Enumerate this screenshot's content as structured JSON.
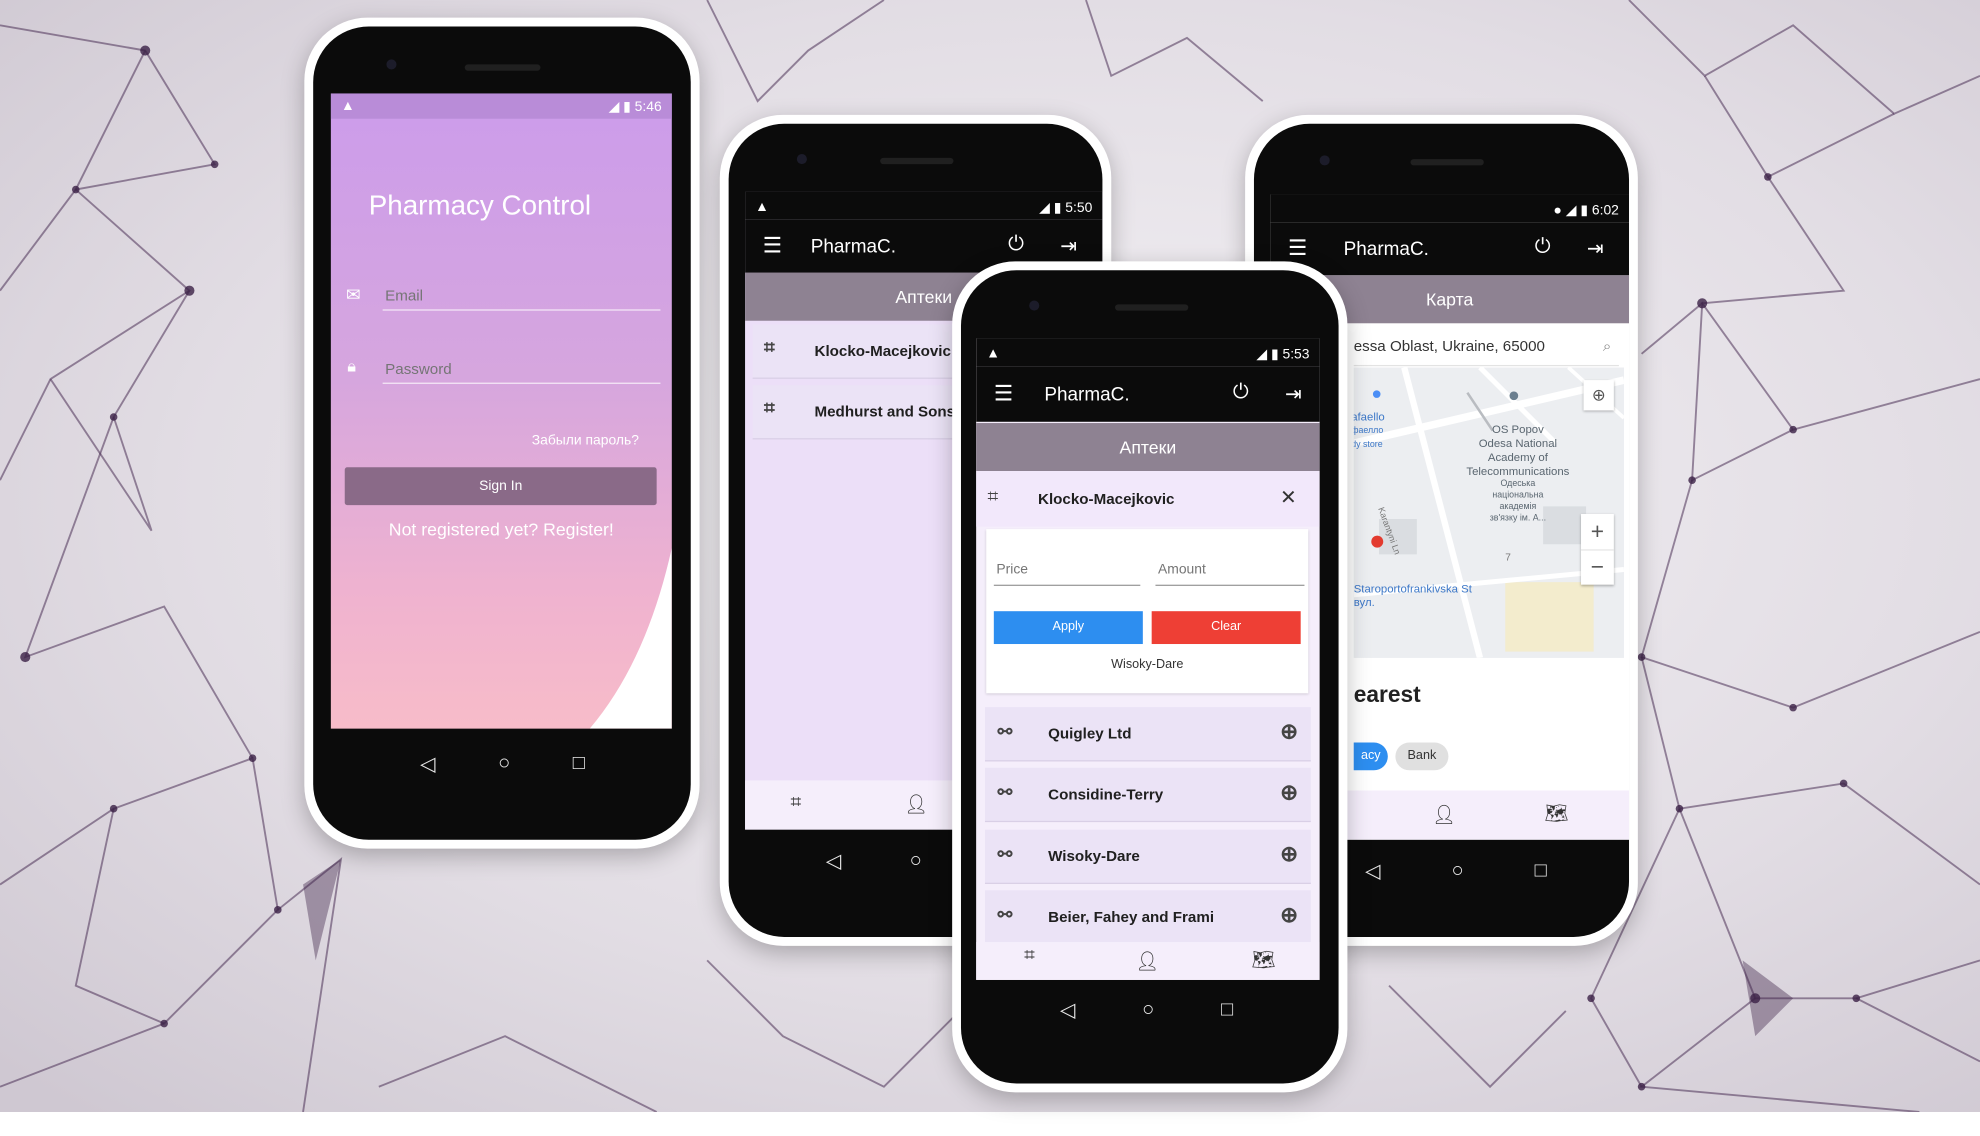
{
  "phone1": {
    "status": {
      "time": "5:46",
      "net": "4G"
    },
    "title": "Pharmacy Control",
    "email_placeholder": "Email",
    "password_placeholder": "Password",
    "forgot_label": "Забыли пароль?",
    "signin_label": "Sign In",
    "register_label": "Not registered yet? Register!"
  },
  "phone2": {
    "status": {
      "time": "5:50",
      "net": "4G"
    },
    "app_title": "PharmaC.",
    "section_title": "Аптеки",
    "items": [
      "Klocko-Macejkovic",
      "Medhurst and Sons"
    ]
  },
  "phone3": {
    "status": {
      "time": "5:53",
      "net": "4G"
    },
    "app_title": "PharmaC.",
    "section_title": "Аптеки",
    "selected_pharmacy": "Klocko-Macejkovic",
    "filter": {
      "price_label": "Price",
      "amount_label": "Amount",
      "apply_label": "Apply",
      "clear_label": "Clear",
      "result_label": "Wisoky-Dare"
    },
    "suppliers": [
      "Quigley Ltd",
      "Considine-Terry",
      "Wisoky-Dare",
      "Beier, Fahey and Frami"
    ]
  },
  "phone4": {
    "status": {
      "time": "6:02",
      "net": "4G"
    },
    "app_title": "PharmaC.",
    "section_title": "Карта",
    "search_value": "essa Oblast, Ukraine, 65000",
    "map_labels": {
      "poi1_line1": "afaello",
      "poi1_line2": "фаелло",
      "poi1_line3": "dy store",
      "poi2_line1": "OS Popov",
      "poi2_line2": "Odesa National",
      "poi2_line3": "Academy of",
      "poi2_line4": "Telecommunications",
      "poi2_line5": "Одеська",
      "poi2_line6": "національна",
      "poi2_line7": "академія",
      "poi2_line8": "зв'язку ім. А...",
      "street1": "Staroportofrankivska St",
      "street2": "вул.",
      "lane": "Karantyni Ln",
      "num": "7"
    },
    "nearest_label": "earest",
    "chips": [
      "acy",
      "Bank"
    ]
  },
  "colors": {
    "accent_purple": "#8e8292",
    "apply_blue": "#2d8ef0",
    "clear_red": "#ee3f35",
    "signin": "#8a6a88"
  }
}
